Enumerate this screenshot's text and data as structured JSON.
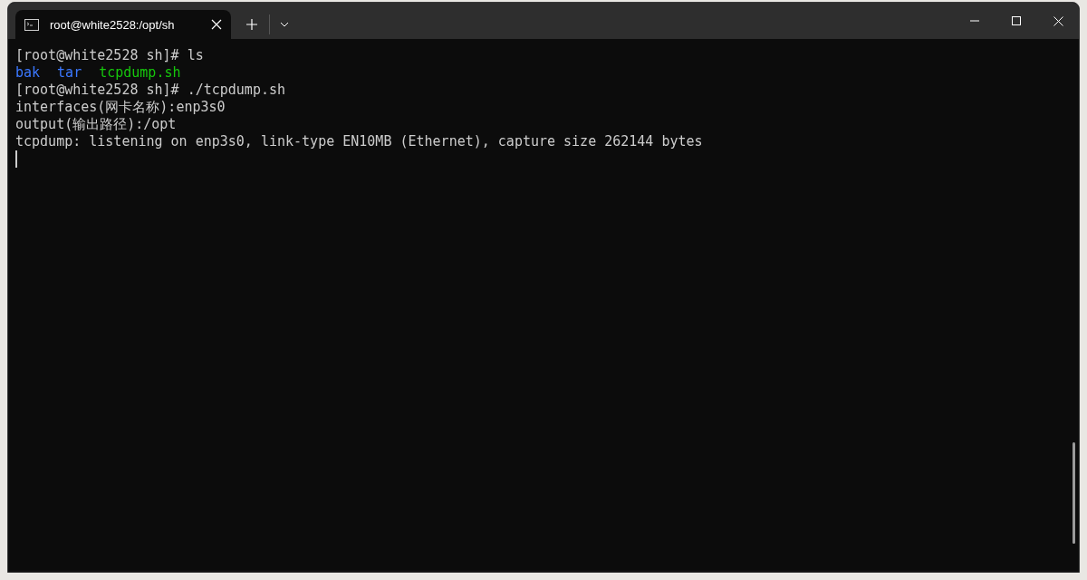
{
  "window": {
    "tab_title": "root@white2528:/opt/sh"
  },
  "terminal": {
    "lines": [
      {
        "kind": "text",
        "text": "[root@white2528 sh]# ls"
      },
      {
        "kind": "files",
        "files": [
          {
            "text": "bak",
            "color": "#3b78ff"
          },
          {
            "text": "tar",
            "color": "#3b78ff"
          },
          {
            "text": "tcpdump.sh",
            "color": "#16c60c"
          }
        ]
      },
      {
        "kind": "text",
        "text": "[root@white2528 sh]# ./tcpdump.sh"
      },
      {
        "kind": "text",
        "text": "interfaces(网卡名称):enp3s0"
      },
      {
        "kind": "text",
        "text": "output(输出路径):/opt"
      },
      {
        "kind": "text",
        "text": "tcpdump: listening on enp3s0, link-type EN10MB (Ethernet), capture size 262144 bytes"
      },
      {
        "kind": "cursor"
      }
    ]
  }
}
